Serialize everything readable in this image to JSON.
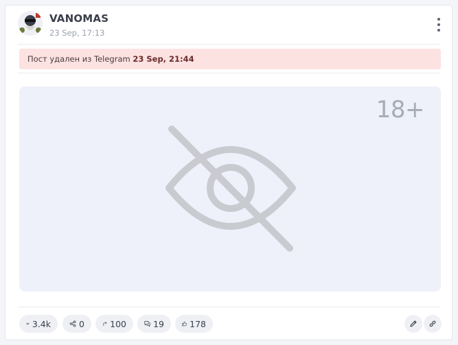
{
  "post": {
    "author": "VANOMAS",
    "date": "23 Sep, 17:13"
  },
  "alert": {
    "text": "Пост удален из Telegram",
    "deleted_at": "23 Sep, 21:44"
  },
  "media": {
    "age_label": "18+",
    "icon": "eye-slash-icon"
  },
  "stats": {
    "views": "3.4k",
    "shares": "0",
    "forwards": "100",
    "comments": "19",
    "reactions": "178"
  },
  "colors": {
    "alert_bg": "#fde2e2",
    "media_bg": "#eef1fa",
    "icon_gray": "#c9cbd1"
  }
}
